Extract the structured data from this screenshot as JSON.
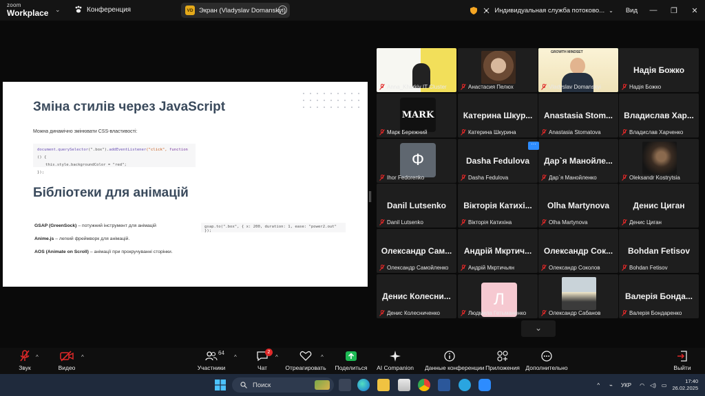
{
  "app": {
    "logo_line1": "zoom",
    "logo_line2": "Workplace",
    "conference_label": "Конференция",
    "screen_share_label": "Экран (Vladyslav Domanskyi)",
    "screen_share_badge": "VD",
    "service_label": "Индивидуальная служба потоково...",
    "view_label": "Вид",
    "accent_color": "#2d8cff",
    "active_speaker_color": "#23d160"
  },
  "slide": {
    "heading1": "Зміна стилів через JavaScript",
    "paragraph1": "Можна динамічно змінювати CSS-властивості:",
    "code1_line1_a": "document.querySelector",
    "code1_line1_b": "(\".box\").",
    "code1_line1_c": "addEventListener",
    "code1_line1_d": "(\"click\", ",
    "code1_line1_e": "function",
    "code1_line1_f": " () {",
    "code1_line2": "this.style.backgroundColor = \"red\";",
    "code1_line3": "});",
    "heading2": "Бібліотеки для анімацій",
    "libs": [
      {
        "name": "GSAP (GreenSock)",
        "desc": " – потужний інструмент для анімацій"
      },
      {
        "name": "Anime.js",
        "desc": " – легкий фреймворк для анімацій."
      },
      {
        "name": "AOS (Animate on Scroll)",
        "desc": " – анімації при прокручуванні сторінки."
      }
    ],
    "code2": "gsap.to(\".box\", { x: 200, duration: 1, ease: \"power2.out\" });"
  },
  "gallery": {
    "tiles": [
      {
        "big": "",
        "cap": "Anna_Kharkiv IT Cluster",
        "photo": "slide"
      },
      {
        "big": "",
        "cap": "Анастасия Пелюх",
        "photo": "face-warm"
      },
      {
        "big": "",
        "cap": "Vladyslav Domanskyi",
        "photo": "speaker",
        "banner": "GROWTH MINDSET"
      },
      {
        "big": "Надія Божко",
        "cap": "Надія Божко"
      },
      {
        "big": "",
        "cap": "Марк Бережний",
        "avatar": "MARK"
      },
      {
        "big": "Катерина Шкур...",
        "cap": "Катерина Шкурина"
      },
      {
        "big": "Anastasia Stom...",
        "cap": "Anastasia Stomatova"
      },
      {
        "big": "Владислав Хар...",
        "cap": "Владислав Харченко"
      },
      {
        "big": "",
        "cap": "Ihor Fedorenko",
        "avatar": "Ф"
      },
      {
        "big": "Dasha Fedulova",
        "cap": "Dasha Fedulova"
      },
      {
        "big": "Дар`я Манойле...",
        "cap": "Дар`я Манойленко"
      },
      {
        "big": "",
        "cap": "Oleksandr Kostrytsia",
        "photo": "dark"
      },
      {
        "big": "Danil Lutsenko",
        "cap": "Danil Lutsenko"
      },
      {
        "big": "Вікторія Катихі...",
        "cap": "Вікторія Катихіна"
      },
      {
        "big": "Olha Martynova",
        "cap": "Olha Martynova"
      },
      {
        "big": "Денис Циган",
        "cap": "Денис Циган"
      },
      {
        "big": "Олександр Сам...",
        "cap": "Олександр Самойленко"
      },
      {
        "big": "Андрій Мкртич...",
        "cap": "Андрій Мкртичьян"
      },
      {
        "big": "Олександр Сок...",
        "cap": "Олександр Соколов"
      },
      {
        "big": "Bohdan Fetisov",
        "cap": "Bohdan Fetisov"
      },
      {
        "big": "Денис Колесни...",
        "cap": "Денис Колесниченко"
      },
      {
        "big": "",
        "cap": "Людмила Гетьманенко",
        "avatar": "Л"
      },
      {
        "big": "",
        "cap": "Олександр Сабанов",
        "photo": "sunset"
      },
      {
        "big": "Валерія Бонда...",
        "cap": "Валерія Бондаренко"
      }
    ],
    "more_glyph": "···"
  },
  "toolbar": {
    "audio": "Звук",
    "video": "Видео",
    "participants": "Участники",
    "participants_count": "64",
    "chat": "Чат",
    "chat_badge": "2",
    "react": "Отреагировать",
    "share": "Поделиться",
    "ai": "AI Companion",
    "info": "Данные конференции",
    "apps": "Приложения",
    "more": "Дополнительно",
    "leave": "Выйти"
  },
  "taskbar": {
    "search_placeholder": "Поиск",
    "lang": "УКР",
    "time": "17:40",
    "date": "26.02.2025"
  }
}
